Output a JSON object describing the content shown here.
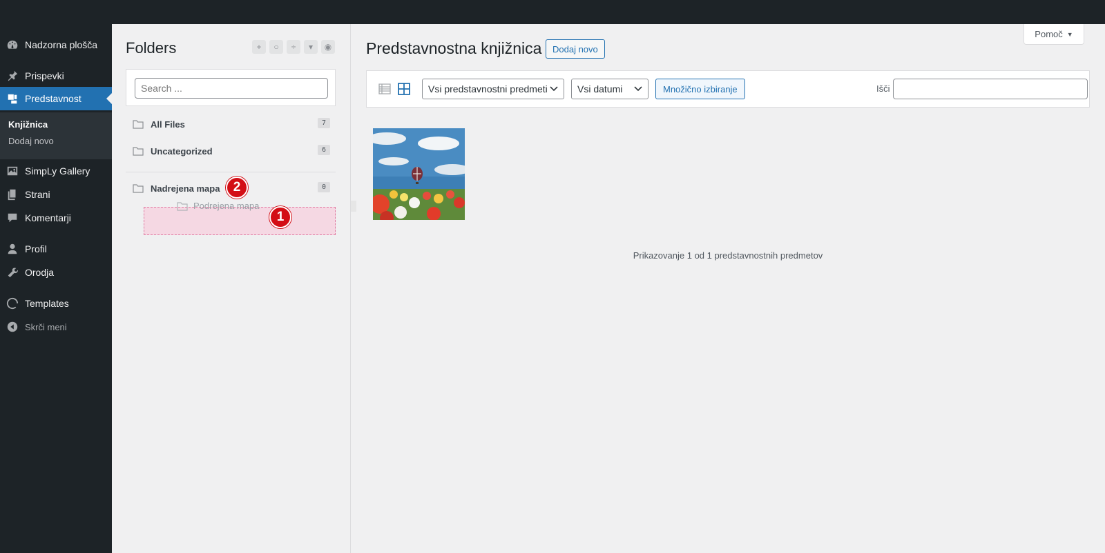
{
  "sidebar": {
    "items": [
      {
        "label": "Nadzorna plošča",
        "icon": "dashboard-icon"
      },
      {
        "label": "Prispevki",
        "icon": "pin-icon"
      },
      {
        "label": "Predstavnost",
        "icon": "media-icon"
      },
      {
        "label": "SimpLy Gallery",
        "icon": "gallery-icon"
      },
      {
        "label": "Strani",
        "icon": "pages-icon"
      },
      {
        "label": "Komentarji",
        "icon": "comment-icon"
      },
      {
        "label": "Profil",
        "icon": "user-icon"
      },
      {
        "label": "Orodja",
        "icon": "wrench-icon"
      },
      {
        "label": "Templates",
        "icon": "templates-icon"
      },
      {
        "label": "Skrči meni",
        "icon": "collapse-icon"
      }
    ],
    "submenu": [
      "Knjižnica",
      "Dodaj novo"
    ]
  },
  "folders": {
    "title": "Folders",
    "search_placeholder": "Search ...",
    "items": [
      {
        "label": "All Files",
        "count": "7"
      },
      {
        "label": "Uncategorized",
        "count": "6"
      },
      {
        "label": "Nadrejena mapa",
        "count": "0"
      }
    ],
    "dragged": "Podrejena mapa",
    "badges": [
      "1",
      "2"
    ]
  },
  "main": {
    "help": "Pomoč",
    "title": "Predstavnostna knjižnica",
    "add_new": "Dodaj novo",
    "filter_type": "Vsi predstavnostni predmeti",
    "filter_date": "Vsi datumi",
    "bulk": "Množično izbiranje",
    "search_label": "Išči",
    "status": "Prikazovanje 1 od 1 predstavnostnih predmetov"
  }
}
